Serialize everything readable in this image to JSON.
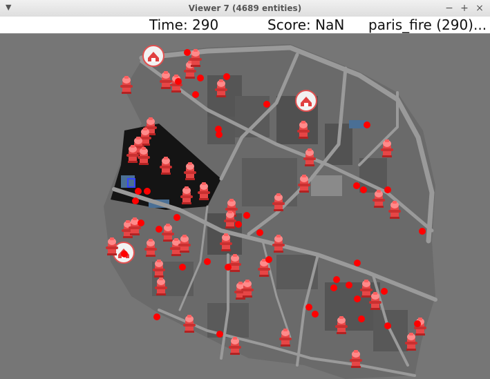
{
  "window": {
    "title": "Viewer 7 (4689 entities)",
    "menu_icon": "chevron-down-icon",
    "buttons": [
      {
        "name": "minimize-button",
        "glyph": "−"
      },
      {
        "name": "maximize-button",
        "glyph": "+"
      },
      {
        "name": "close-button",
        "glyph": "×"
      }
    ]
  },
  "status": {
    "time": "Time: 290",
    "score": "Score: NaN",
    "scenario": "paris_fire (290)..."
  },
  "colors": {
    "background": "#767676",
    "roads": "#9a9a9a",
    "buildings": "#4f4f4f",
    "burning_buildings": "#111111",
    "water": "#4a6f95",
    "hydrant": "#e64646",
    "agent_dot": "#ff0000"
  },
  "map_entities": {
    "fire_stations": 2,
    "refuges": 1,
    "icons": [
      "fire-station-icon",
      "refuge-icon",
      "fire-hydrant-icon",
      "fire-brigade-agent-icon"
    ]
  }
}
